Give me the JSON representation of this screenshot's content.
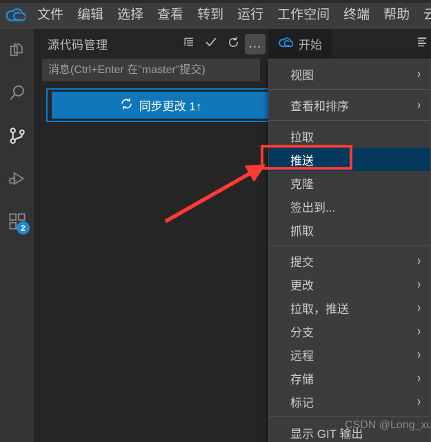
{
  "titlebar": {
    "logo_icon": "cloud-logo-icon",
    "menus": [
      {
        "label": "文件",
        "name": "menubar-file"
      },
      {
        "label": "编辑",
        "name": "menubar-edit"
      },
      {
        "label": "选择",
        "name": "menubar-selection"
      },
      {
        "label": "查看",
        "name": "menubar-view"
      },
      {
        "label": "转到",
        "name": "menubar-go"
      },
      {
        "label": "运行",
        "name": "menubar-run"
      },
      {
        "label": "工作空间",
        "name": "menubar-workspace"
      },
      {
        "label": "终端",
        "name": "menubar-terminal"
      },
      {
        "label": "帮助",
        "name": "menubar-help"
      },
      {
        "label": "云 IDE 扩",
        "name": "menubar-cloud-ide"
      }
    ]
  },
  "activitybar": {
    "items": [
      {
        "icon": "files-explorer-icon",
        "active": false,
        "badge": ""
      },
      {
        "icon": "search-icon",
        "active": false,
        "badge": ""
      },
      {
        "icon": "source-control-icon",
        "active": true,
        "badge": ""
      },
      {
        "icon": "run-and-debug-icon",
        "active": false,
        "badge": ""
      },
      {
        "icon": "extensions-icon",
        "active": false,
        "badge": "2"
      }
    ]
  },
  "sidebar": {
    "title": "源代码管理",
    "actions": [
      {
        "icon": "view-as-list-icon",
        "hovered": false
      },
      {
        "icon": "commit-check-icon",
        "hovered": false
      },
      {
        "icon": "refresh-icon",
        "hovered": false
      },
      {
        "icon": "more-actions-icon",
        "hovered": true,
        "label": "..."
      }
    ],
    "commit_input": {
      "value": "",
      "placeholder": "消息(Ctrl+Enter 在\"master\"提交)"
    },
    "sync_button": {
      "icon": "sync-icon",
      "label": "同步更改 1↑",
      "color": "#1177bb",
      "focus_border_color": "#007fd4"
    }
  },
  "editor": {
    "tabs": [
      {
        "label": "开始",
        "icon": "cloud-logo-icon",
        "active": true
      }
    ],
    "tabbar_actions": [
      {
        "icon": "editor-layout-icon"
      }
    ]
  },
  "context_menu": {
    "items": [
      {
        "label": "视图",
        "submenu": true,
        "selected": false,
        "separator_after": true
      },
      {
        "label": "查看和排序",
        "submenu": true,
        "selected": false,
        "separator_after": true
      },
      {
        "label": "拉取",
        "submenu": false,
        "selected": false,
        "separator_after": false
      },
      {
        "label": "推送",
        "submenu": false,
        "selected": true,
        "separator_after": false
      },
      {
        "label": "克隆",
        "submenu": false,
        "selected": false,
        "separator_after": false
      },
      {
        "label": "签出到...",
        "submenu": false,
        "selected": false,
        "separator_after": false
      },
      {
        "label": "抓取",
        "submenu": false,
        "selected": false,
        "separator_after": true
      },
      {
        "label": "提交",
        "submenu": true,
        "selected": false,
        "separator_after": false
      },
      {
        "label": "更改",
        "submenu": true,
        "selected": false,
        "separator_after": false
      },
      {
        "label": "拉取，推送",
        "submenu": true,
        "selected": false,
        "separator_after": false
      },
      {
        "label": "分支",
        "submenu": true,
        "selected": false,
        "separator_after": false
      },
      {
        "label": "远程",
        "submenu": true,
        "selected": false,
        "separator_after": false
      },
      {
        "label": "存储",
        "submenu": true,
        "selected": false,
        "separator_after": false
      },
      {
        "label": "标记",
        "submenu": true,
        "selected": false,
        "separator_after": true
      },
      {
        "label": "显示 GIT 输出",
        "submenu": false,
        "selected": false,
        "separator_after": false
      }
    ],
    "chevron_glyph": "›",
    "selected_bg": "#04395e"
  },
  "annotations": {
    "highlight_box_color": "#fe3a34",
    "arrow_color": "#fe3a34",
    "watermark": "CSDN @Long_xu"
  }
}
